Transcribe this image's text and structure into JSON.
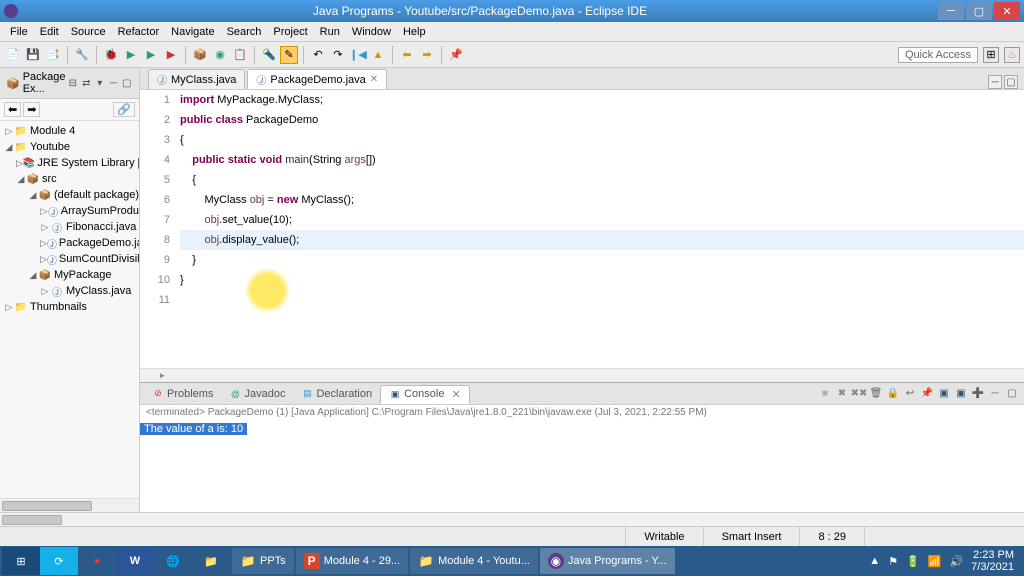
{
  "window": {
    "title": "Java Programs - Youtube/src/PackageDemo.java - Eclipse IDE"
  },
  "menus": [
    "File",
    "Edit",
    "Source",
    "Refactor",
    "Navigate",
    "Search",
    "Project",
    "Run",
    "Window",
    "Help"
  ],
  "quick_access": "Quick Access",
  "sidebar": {
    "title": "Package Ex...",
    "nodes": {
      "module4": "Module 4",
      "youtube": "Youtube",
      "jre": "JRE System Library [Jav",
      "src": "src",
      "defpkg": "(default package)",
      "arraysum": "ArraySumProdu",
      "fibonacci": "Fibonacci.java",
      "packagedemo": "PackageDemo.ja",
      "sumcount": "SumCountDivisil",
      "mypackage": "MyPackage",
      "myclass": "MyClass.java",
      "thumbnails": "Thumbnails"
    }
  },
  "tabs": {
    "t1": "MyClass.java",
    "t2": "PackageDemo.java"
  },
  "code": {
    "line_nums": [
      "1",
      "2",
      "3",
      "4",
      "5",
      "6",
      "7",
      "8",
      "9",
      "10",
      "11"
    ],
    "l1a": "import",
    "l1b": " MyPackage.MyClass;",
    "l2a": "public",
    "l2b": "class",
    "l2c": " PackageDemo",
    "l3": "{",
    "l4a": "public",
    "l4b": "static",
    "l4c": "void",
    "l4d": "main",
    "l4e": "(String ",
    "l4f": "args",
    "l4g": "[])",
    "l5": "    {",
    "l6a": "        MyClass ",
    "l6b": "obj",
    "l6c": " = ",
    "l6d": "new",
    "l6e": " MyClass();",
    "l7a": "        ",
    "l7b": "obj",
    "l7c": ".set_value(10);",
    "l8a": "        ",
    "l8b": "obj",
    "l8c": ".display_value();",
    "l9": "    }",
    "l10": "}",
    "l11": ""
  },
  "bottom_tabs": {
    "problems": "Problems",
    "javadoc": "Javadoc",
    "declaration": "Declaration",
    "console": "Console"
  },
  "console": {
    "info": "<terminated> PackageDemo (1) [Java Application] C:\\Program Files\\Java\\jre1.8.0_221\\bin\\javaw.exe (Jul 3, 2021, 2:22:55 PM)",
    "output": "The value of a is: 10"
  },
  "status": {
    "writable": "Writable",
    "insert": "Smart Insert",
    "pos": "8 : 29"
  },
  "taskbar": {
    "ppts": "PPTs",
    "module4": "Module 4 - 29...",
    "youtube": "Module 4 - Youtu...",
    "javaprogs": "Java Programs - Y...",
    "time": "2:23 PM",
    "date": "7/3/2021"
  }
}
